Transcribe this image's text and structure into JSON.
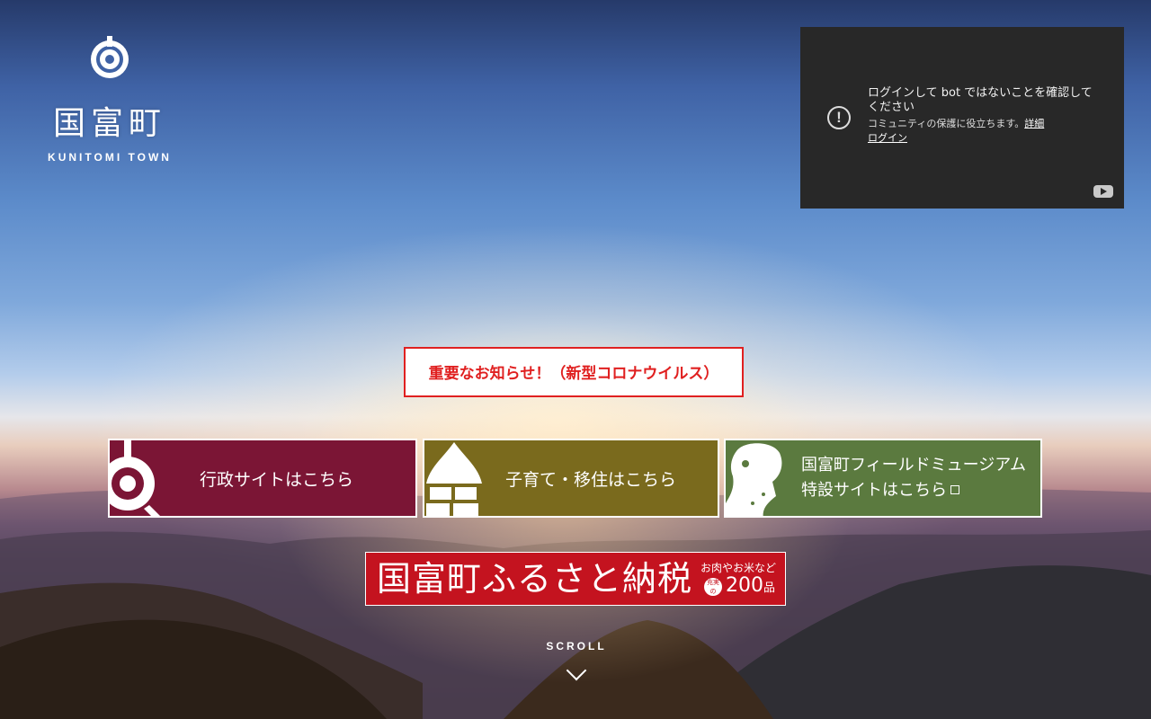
{
  "brand": {
    "name": "国富町",
    "sub": "KUNITOMI TOWN"
  },
  "video": {
    "title": "ログインして bot ではないことを確認してください",
    "desc": "コミュニティの保護に役立ちます。",
    "link1": "詳細",
    "link2": "ログイン",
    "alert_icon": "!"
  },
  "notice": {
    "label": "重要なお知らせ！（新型コロナウイルス）"
  },
  "cards": [
    {
      "label": "行政サイトはこちら"
    },
    {
      "label": "子育て・移住はこちら"
    },
    {
      "label_line1": "国富町フィールドミュージアム",
      "label_line2": "特設サイトはこちら"
    }
  ],
  "furusato": {
    "title": "国富町ふるさと納税",
    "sub": "お肉やお米など",
    "badge": "充実の",
    "count": "200",
    "unit": "品"
  },
  "scroll": {
    "label": "SCROLL"
  },
  "colors": {
    "notice": "#e02020",
    "card1": "#7b1535",
    "card2": "#7a6a1d",
    "card3": "#5b7a3f",
    "furusato": "#c4131f"
  }
}
